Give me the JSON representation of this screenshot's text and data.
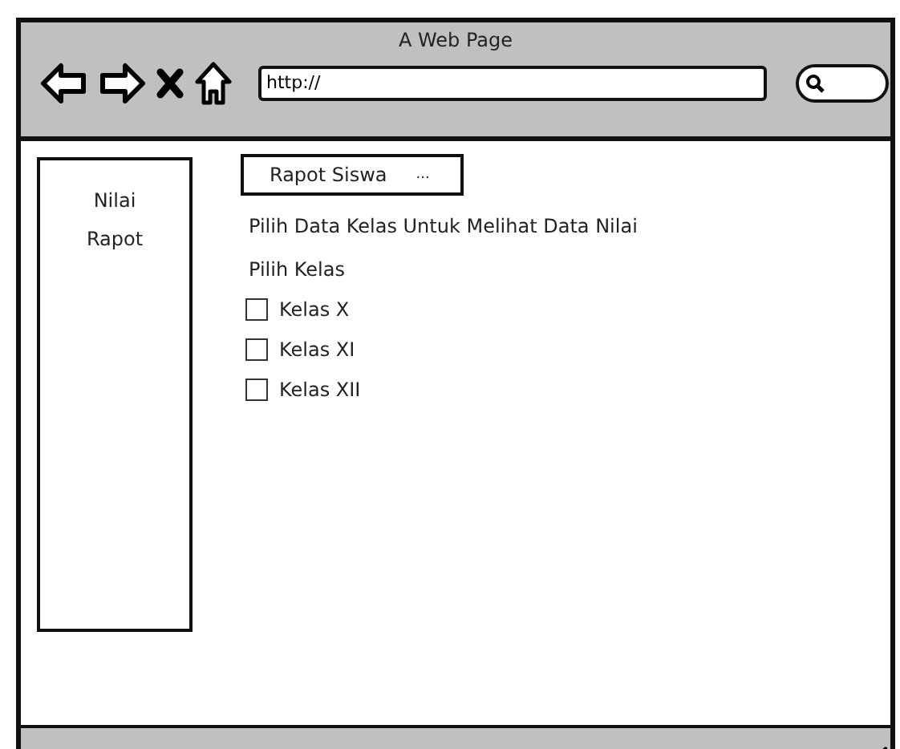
{
  "window": {
    "title": "A Web Page"
  },
  "address_bar": {
    "value": "http://"
  },
  "sidebar": {
    "items": [
      {
        "label": "Nilai"
      },
      {
        "label": "Rapot"
      }
    ]
  },
  "menu_button": {
    "label": "Rapot Siswa",
    "more": "..."
  },
  "instruction": "Pilih Data Kelas Untuk Melihat Data Nilai",
  "section_label": "Pilih Kelas",
  "checkboxes": [
    {
      "label": "Kelas X",
      "checked": false
    },
    {
      "label": "Kelas XI",
      "checked": false
    },
    {
      "label": "Kelas XII",
      "checked": false
    }
  ]
}
